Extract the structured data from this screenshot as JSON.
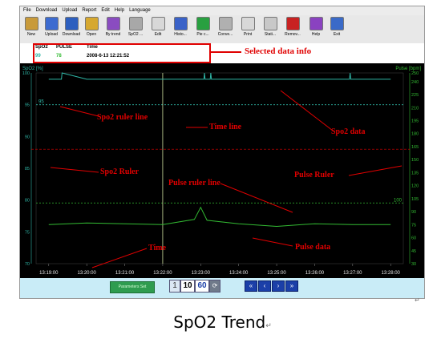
{
  "menu": [
    "File",
    "Download",
    "Upload",
    "Report",
    "Edit",
    "Help",
    "Language"
  ],
  "toolbar": [
    {
      "label": "New",
      "icon": "new-icon",
      "color": "#c89a3a"
    },
    {
      "label": "Upload",
      "icon": "upload-icon",
      "color": "#3c6bd0"
    },
    {
      "label": "Download",
      "icon": "download-icon",
      "color": "#2d5fbf"
    },
    {
      "label": "Open",
      "icon": "open-icon",
      "color": "#d6a830"
    },
    {
      "label": "By trend",
      "icon": "trend-icon",
      "color": "#8a4cc0"
    },
    {
      "label": "SpO2 ...",
      "icon": "spo2-icon",
      "color": "#a8a8a8"
    },
    {
      "label": "Edit",
      "icon": "edit-icon",
      "color": "#d8d8d8"
    },
    {
      "label": "Histo...",
      "icon": "histogram-icon",
      "color": "#3a62c8"
    },
    {
      "label": "Pie c...",
      "icon": "pie-chart-icon",
      "color": "#28a040"
    },
    {
      "label": "Conve...",
      "icon": "convert-icon",
      "color": "#b0b0b0"
    },
    {
      "label": "Print",
      "icon": "print-icon",
      "color": "#d8d8d8"
    },
    {
      "label": "Stati...",
      "icon": "statistics-icon",
      "color": "#c8c8c8"
    },
    {
      "label": "Remov...",
      "icon": "remove-icon",
      "color": "#c82222"
    },
    {
      "label": "Help",
      "icon": "help-icon",
      "color": "#8a42c0"
    },
    {
      "label": "Exit",
      "icon": "exit-icon",
      "color": "#3a6ac8"
    }
  ],
  "info": {
    "headers": [
      "SpO2",
      "PULSE",
      "Time"
    ],
    "values": [
      "99",
      "78",
      "2008-6-13 12:21:52"
    ],
    "annotation": "Selected data info"
  },
  "chart": {
    "spo2_axis_title": "SpO2 [%]",
    "pulse_axis_title": "Pulse [bpm]",
    "spo2_ticks": [
      "100",
      "95",
      "90",
      "85",
      "80",
      "75",
      "70"
    ],
    "pulse_ticks": [
      "250",
      "240",
      "225",
      "210",
      "195",
      "180",
      "165",
      "150",
      "135",
      "120",
      "105",
      "90",
      "75",
      "60",
      "45",
      "30"
    ],
    "time_ticks": [
      "13:19:00",
      "13:20:00",
      "13:21:00",
      "13:22:00",
      "13:23:00",
      "13:24:00",
      "13:25:00",
      "13:26:00",
      "13:27:00",
      "13:28:00"
    ],
    "spo2_ruler_value": "95",
    "pulse_ruler_value": "100",
    "colors": {
      "spo2": "#2fb6a6",
      "pulse": "#33bb33",
      "ruler": "#e00000",
      "time_line": "#cfe0a0",
      "annotation": "#e00000"
    }
  },
  "chart_data": {
    "type": "line",
    "series": [
      {
        "name": "SpO2",
        "axis": "left",
        "unit": "%",
        "x": [
          "13:19:00",
          "13:19:20",
          "13:19:21",
          "13:20:00",
          "13:23:05",
          "13:23:06",
          "13:23:07",
          "13:23:15",
          "13:23:16",
          "13:23:17",
          "13:26:55",
          "13:26:56",
          "13:26:57",
          "13:28:00"
        ],
        "values": [
          99,
          99,
          100,
          99,
          99,
          100,
          99,
          99,
          100,
          99,
          99,
          100,
          99,
          99
        ]
      },
      {
        "name": "Pulse",
        "axis": "right",
        "unit": "bpm",
        "x": [
          "13:19:00",
          "13:20:00",
          "13:21:00",
          "13:22:00",
          "13:22:50",
          "13:23:00",
          "13:23:10",
          "13:24:00",
          "13:25:00",
          "13:26:00",
          "13:27:00",
          "13:28:00"
        ],
        "values": [
          75,
          77,
          76,
          75,
          81,
          95,
          80,
          76,
          73,
          76,
          75,
          75
        ]
      }
    ],
    "ylim_left": [
      70,
      100
    ],
    "ylim_right": [
      30,
      250
    ],
    "xlim": [
      "13:18:40",
      "13:28:20"
    ]
  },
  "annotations": [
    "Spo2 ruler line",
    "Time line",
    "Spo2 data",
    "Spo2 Ruler",
    "Pulse ruler line",
    "Pulse Ruler",
    "Time",
    "Pulse data"
  ],
  "bottom": {
    "params_label": "Parameters Set",
    "zoom": [
      "1",
      "10",
      "60"
    ],
    "nav": [
      "«",
      "‹",
      "›",
      "»"
    ]
  },
  "caption": "SpO2 Trend"
}
